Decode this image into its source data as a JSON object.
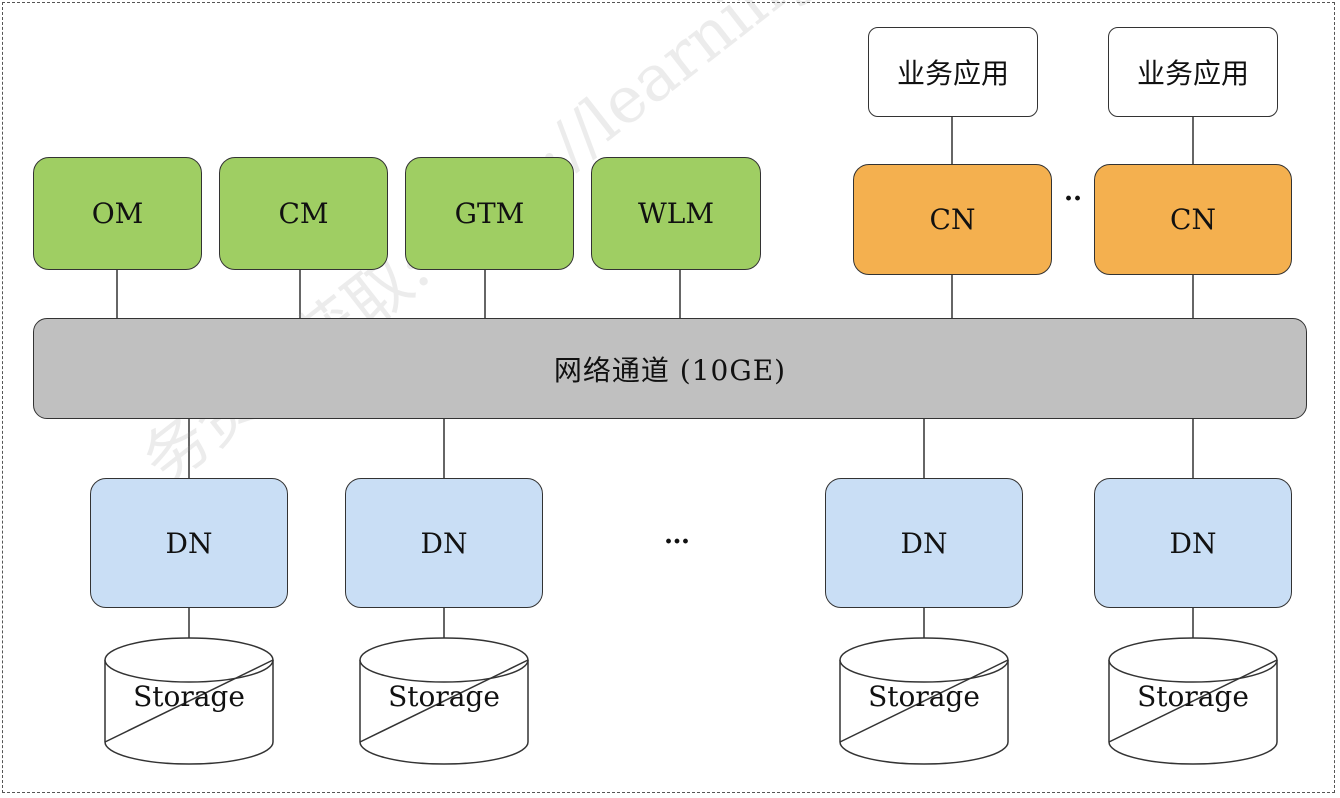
{
  "components": {
    "om": "OM",
    "cm": "CM",
    "gtm": "GTM",
    "wlm": "WLM",
    "cn1": "CN",
    "cn2": "CN",
    "cn_ellipsis": "··"
  },
  "apps": {
    "app1": "业务应用",
    "app2": "业务应用"
  },
  "network": {
    "label": "网络通道 (10GE)"
  },
  "data_nodes": {
    "dn1": "DN",
    "dn2": "DN",
    "dn3": "DN",
    "dn4": "DN",
    "ellipsis": "…"
  },
  "storage": {
    "s1": "Storage",
    "s2": "Storage",
    "s3": "Storage",
    "s4": "Storage"
  },
  "watermark": "务资料获取: http://learning.huawei.com",
  "colors": {
    "management": "#9fce63",
    "coordinator": "#f4b04f",
    "datanode": "#c9def5",
    "network": "#c0c0c0"
  }
}
